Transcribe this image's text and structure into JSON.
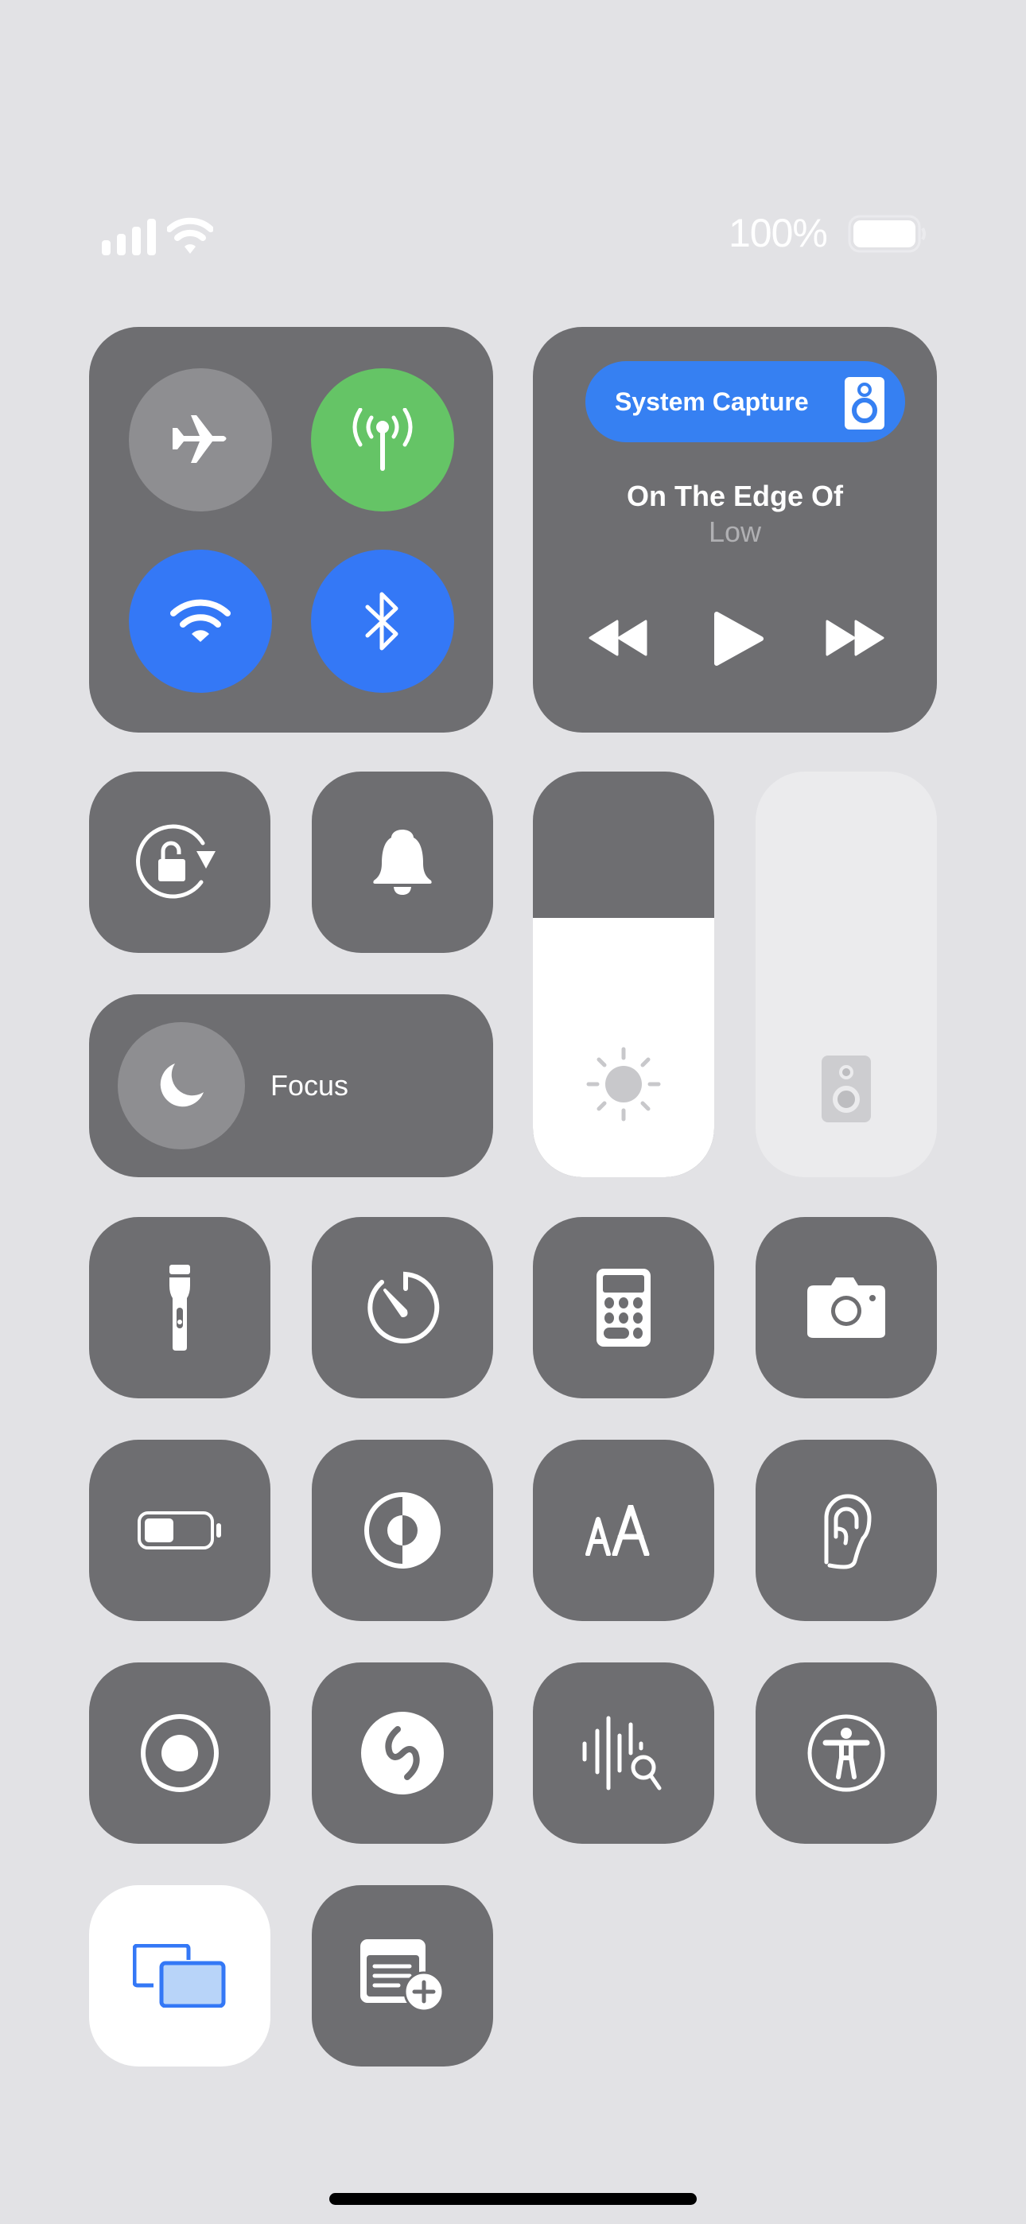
{
  "status_bar": {
    "cellular_bars": 4,
    "wifi": "wifi-icon",
    "battery_percent_label": "100%",
    "battery_level": 1.0
  },
  "connectivity": {
    "airplane_mode": {
      "label": "Airplane Mode",
      "icon": "airplane-icon",
      "on": false,
      "color": "#8e8e91"
    },
    "cellular_data": {
      "label": "Cellular Data",
      "icon": "antenna-icon",
      "on": true,
      "color": "#65c466"
    },
    "wifi": {
      "label": "Wi-Fi",
      "icon": "wifi-icon",
      "on": true,
      "color": "#3478f6"
    },
    "bluetooth": {
      "label": "Bluetooth",
      "icon": "bluetooth-icon",
      "on": true,
      "color": "#3478f6"
    }
  },
  "now_playing": {
    "output_label": "System Capture",
    "output_icon": "speaker-icon",
    "title": "On The Edge Of",
    "artist": "Low",
    "controls": [
      "rewind-icon",
      "play-icon",
      "fast-forward-icon"
    ]
  },
  "toggles": {
    "orientation_lock": {
      "icon": "rotation-lock-icon",
      "label": "Orientation Lock"
    },
    "silent_mode": {
      "icon": "bell-icon",
      "label": "Silent Mode"
    },
    "focus": {
      "label": "Focus",
      "icon": "moon-icon"
    }
  },
  "sliders": {
    "brightness": {
      "icon": "sun-icon",
      "level": 0.64
    },
    "volume": {
      "icon": "speaker-icon",
      "level": 0.0,
      "enabled": false
    }
  },
  "shortcuts": [
    {
      "name": "flashlight",
      "icon": "flashlight-icon"
    },
    {
      "name": "timer",
      "icon": "timer-icon"
    },
    {
      "name": "calculator",
      "icon": "calculator-icon"
    },
    {
      "name": "camera",
      "icon": "camera-icon"
    },
    {
      "name": "low-power-mode",
      "icon": "battery-icon"
    },
    {
      "name": "dark-mode",
      "icon": "appearance-icon"
    },
    {
      "name": "text-size",
      "icon": "text-size-icon"
    },
    {
      "name": "hearing",
      "icon": "ear-icon"
    },
    {
      "name": "screen-recording",
      "icon": "record-icon"
    },
    {
      "name": "music-recognition",
      "icon": "shazam-icon"
    },
    {
      "name": "sound-recognition",
      "icon": "sound-recognition-icon"
    },
    {
      "name": "accessibility-shortcut",
      "icon": "accessibility-icon"
    },
    {
      "name": "screen-mirroring",
      "icon": "screen-mirroring-icon",
      "active": true
    },
    {
      "name": "quick-note",
      "icon": "quick-note-icon"
    }
  ],
  "colors": {
    "background": "#e2e2e5",
    "tile": "#6e6e71",
    "accent_blue": "#3478f6",
    "accent_green": "#65c466"
  }
}
